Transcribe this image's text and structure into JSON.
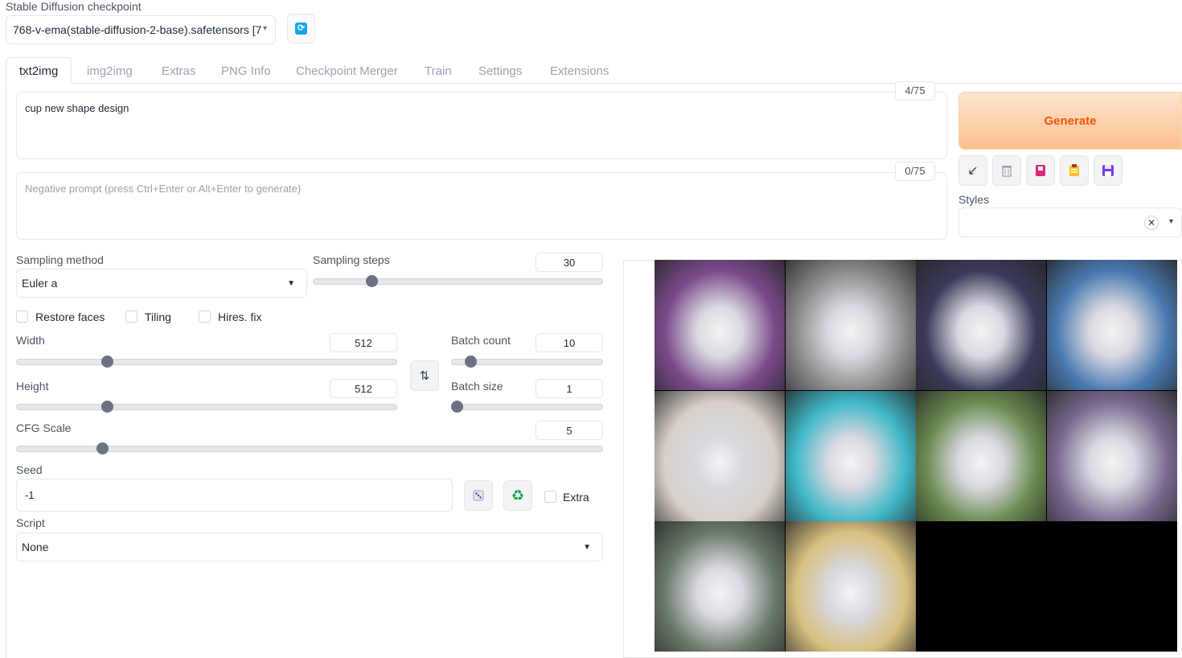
{
  "checkpoint": {
    "label": "Stable Diffusion checkpoint",
    "value": "768-v-ema(stable-diffusion-2-base).safetensors [7",
    "refresh_icon": "refresh-icon"
  },
  "tabs": [
    {
      "label": "txt2img",
      "active": true
    },
    {
      "label": "img2img"
    },
    {
      "label": "Extras"
    },
    {
      "label": "PNG Info"
    },
    {
      "label": "Checkpoint Merger"
    },
    {
      "label": "Train"
    },
    {
      "label": "Settings"
    },
    {
      "label": "Extensions"
    }
  ],
  "prompt": {
    "value": "cup new shape design",
    "counter": "4/75"
  },
  "negative_prompt": {
    "placeholder": "Negative prompt (press Ctrl+Enter or Alt+Enter to generate)",
    "counter": "0/75"
  },
  "generate": {
    "label": "Generate"
  },
  "toolbar": {
    "icons": [
      "arrow-icon",
      "trash-icon",
      "bookmark-icon",
      "clipboard-icon",
      "save-icon"
    ]
  },
  "styles": {
    "label": "Styles",
    "clear": "✕"
  },
  "sampling_method": {
    "label": "Sampling method",
    "value": "Euler a"
  },
  "sampling_steps": {
    "label": "Sampling steps",
    "value": "30",
    "fraction": 0.19
  },
  "checkboxes": {
    "restore_faces": "Restore faces",
    "tiling": "Tiling",
    "hires_fix": "Hires. fix"
  },
  "width": {
    "label": "Width",
    "value": "512",
    "fraction": 0.23
  },
  "height": {
    "label": "Height",
    "value": "512",
    "fraction": 0.23
  },
  "batch_count": {
    "label": "Batch count",
    "value": "10",
    "fraction": 0.1
  },
  "batch_size": {
    "label": "Batch size",
    "value": "1",
    "fraction": 0.0
  },
  "cfg_scale": {
    "label": "CFG Scale",
    "value": "5",
    "fraction": 0.14
  },
  "seed": {
    "label": "Seed",
    "value": "-1",
    "extra": "Extra",
    "dice_icon": "dice-icon",
    "recycle_icon": "recycle-icon"
  },
  "script": {
    "label": "Script",
    "value": "None"
  },
  "gallery": {
    "image_count": 10,
    "colors": [
      "#7a4a8a",
      "#8a8a8a",
      "#3a3a5a",
      "#4a7ab0",
      "#d8d0c8",
      "#40b8c8",
      "#6a8a50",
      "#7a6a90",
      "#6a7a6a",
      "#d8c080"
    ]
  }
}
